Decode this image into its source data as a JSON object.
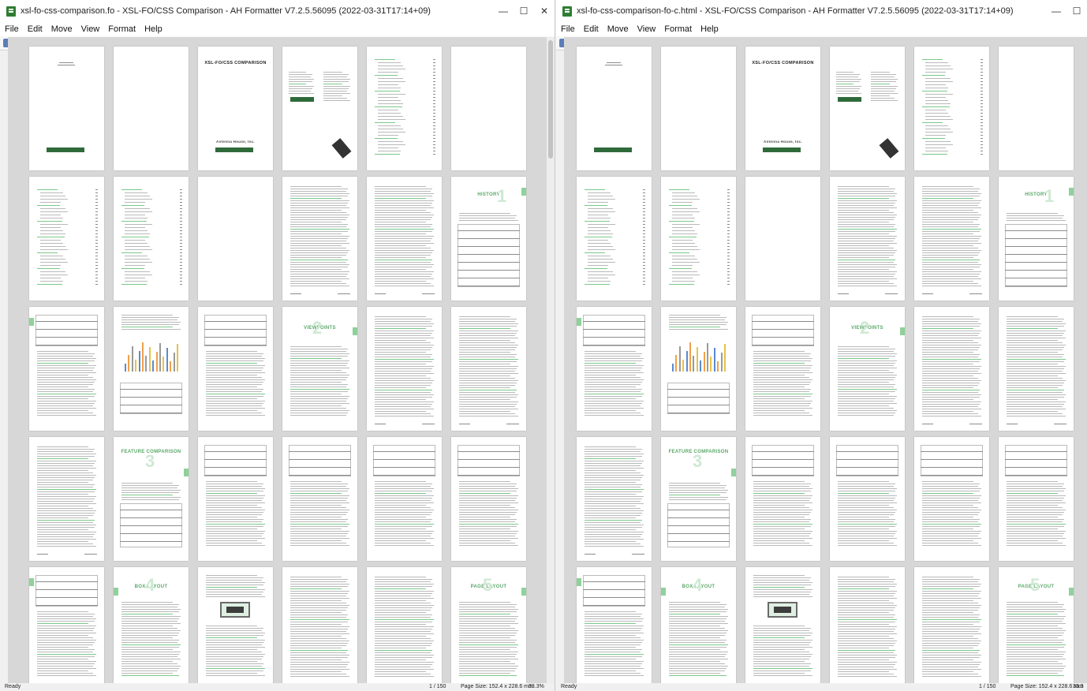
{
  "windows": [
    {
      "title": "xsl-fo-css-comparison.fo - XSL-FO/CSS Comparison - AH Formatter V7.2.5.56095 (2022-03-31T17:14+09)",
      "controls": {
        "minimize": "—",
        "maximize": "☐",
        "close": "✕"
      },
      "status": {
        "left": "Ready",
        "page": "1 / 150",
        "size": "Page Size: 152.4 x 228.6 mm",
        "zoom": "33.3%"
      }
    },
    {
      "title": "xsl-fo-css-comparison-fo-c.html - XSL-FO/CSS Comparison - AH Formatter V7.2.5.56095 (2022-03-31T17:14+09)",
      "controls": {
        "minimize": "—",
        "maximize": "☐",
        "close": "✕"
      },
      "status": {
        "left": "Ready",
        "page": "1 / 150",
        "size": "Page Size: 152.4 x 228.6 mm",
        "zoom": "33.3"
      }
    }
  ],
  "menu": [
    "File",
    "Edit",
    "Move",
    "View",
    "Format",
    "Help"
  ],
  "page_titles": {
    "cover": "XSL-FO/CSS COMPARISON",
    "history": "HISTORY",
    "viewpoints": "VIEWPOINTS",
    "feature": "FEATURE COMPARISON",
    "box": "BOX LAYOUT",
    "pagelayout": "PAGE LAYOUT",
    "publisher": "Antenna House, Inc."
  },
  "chapter_numbers": [
    "1",
    "2",
    "3",
    "4",
    "5"
  ],
  "toolbar_icons": [
    "new-doc-icon",
    "open-icon",
    "save-icon",
    "print-icon",
    "copy-icon",
    "paste-icon",
    "search-icon",
    "first-page-icon",
    "prev-page-icon",
    "next-page-icon",
    "last-page-icon",
    "zoom-in-icon",
    "zoom-out-icon",
    "fit-page-icon",
    "fit-width-icon",
    "single-page-icon",
    "multi-page-icon",
    "help-icon"
  ],
  "colors": {
    "accent": "#5aa86a",
    "logo": "#2f6b3a",
    "canvas": "#d7d7d7",
    "tab": "#8fd19b"
  }
}
